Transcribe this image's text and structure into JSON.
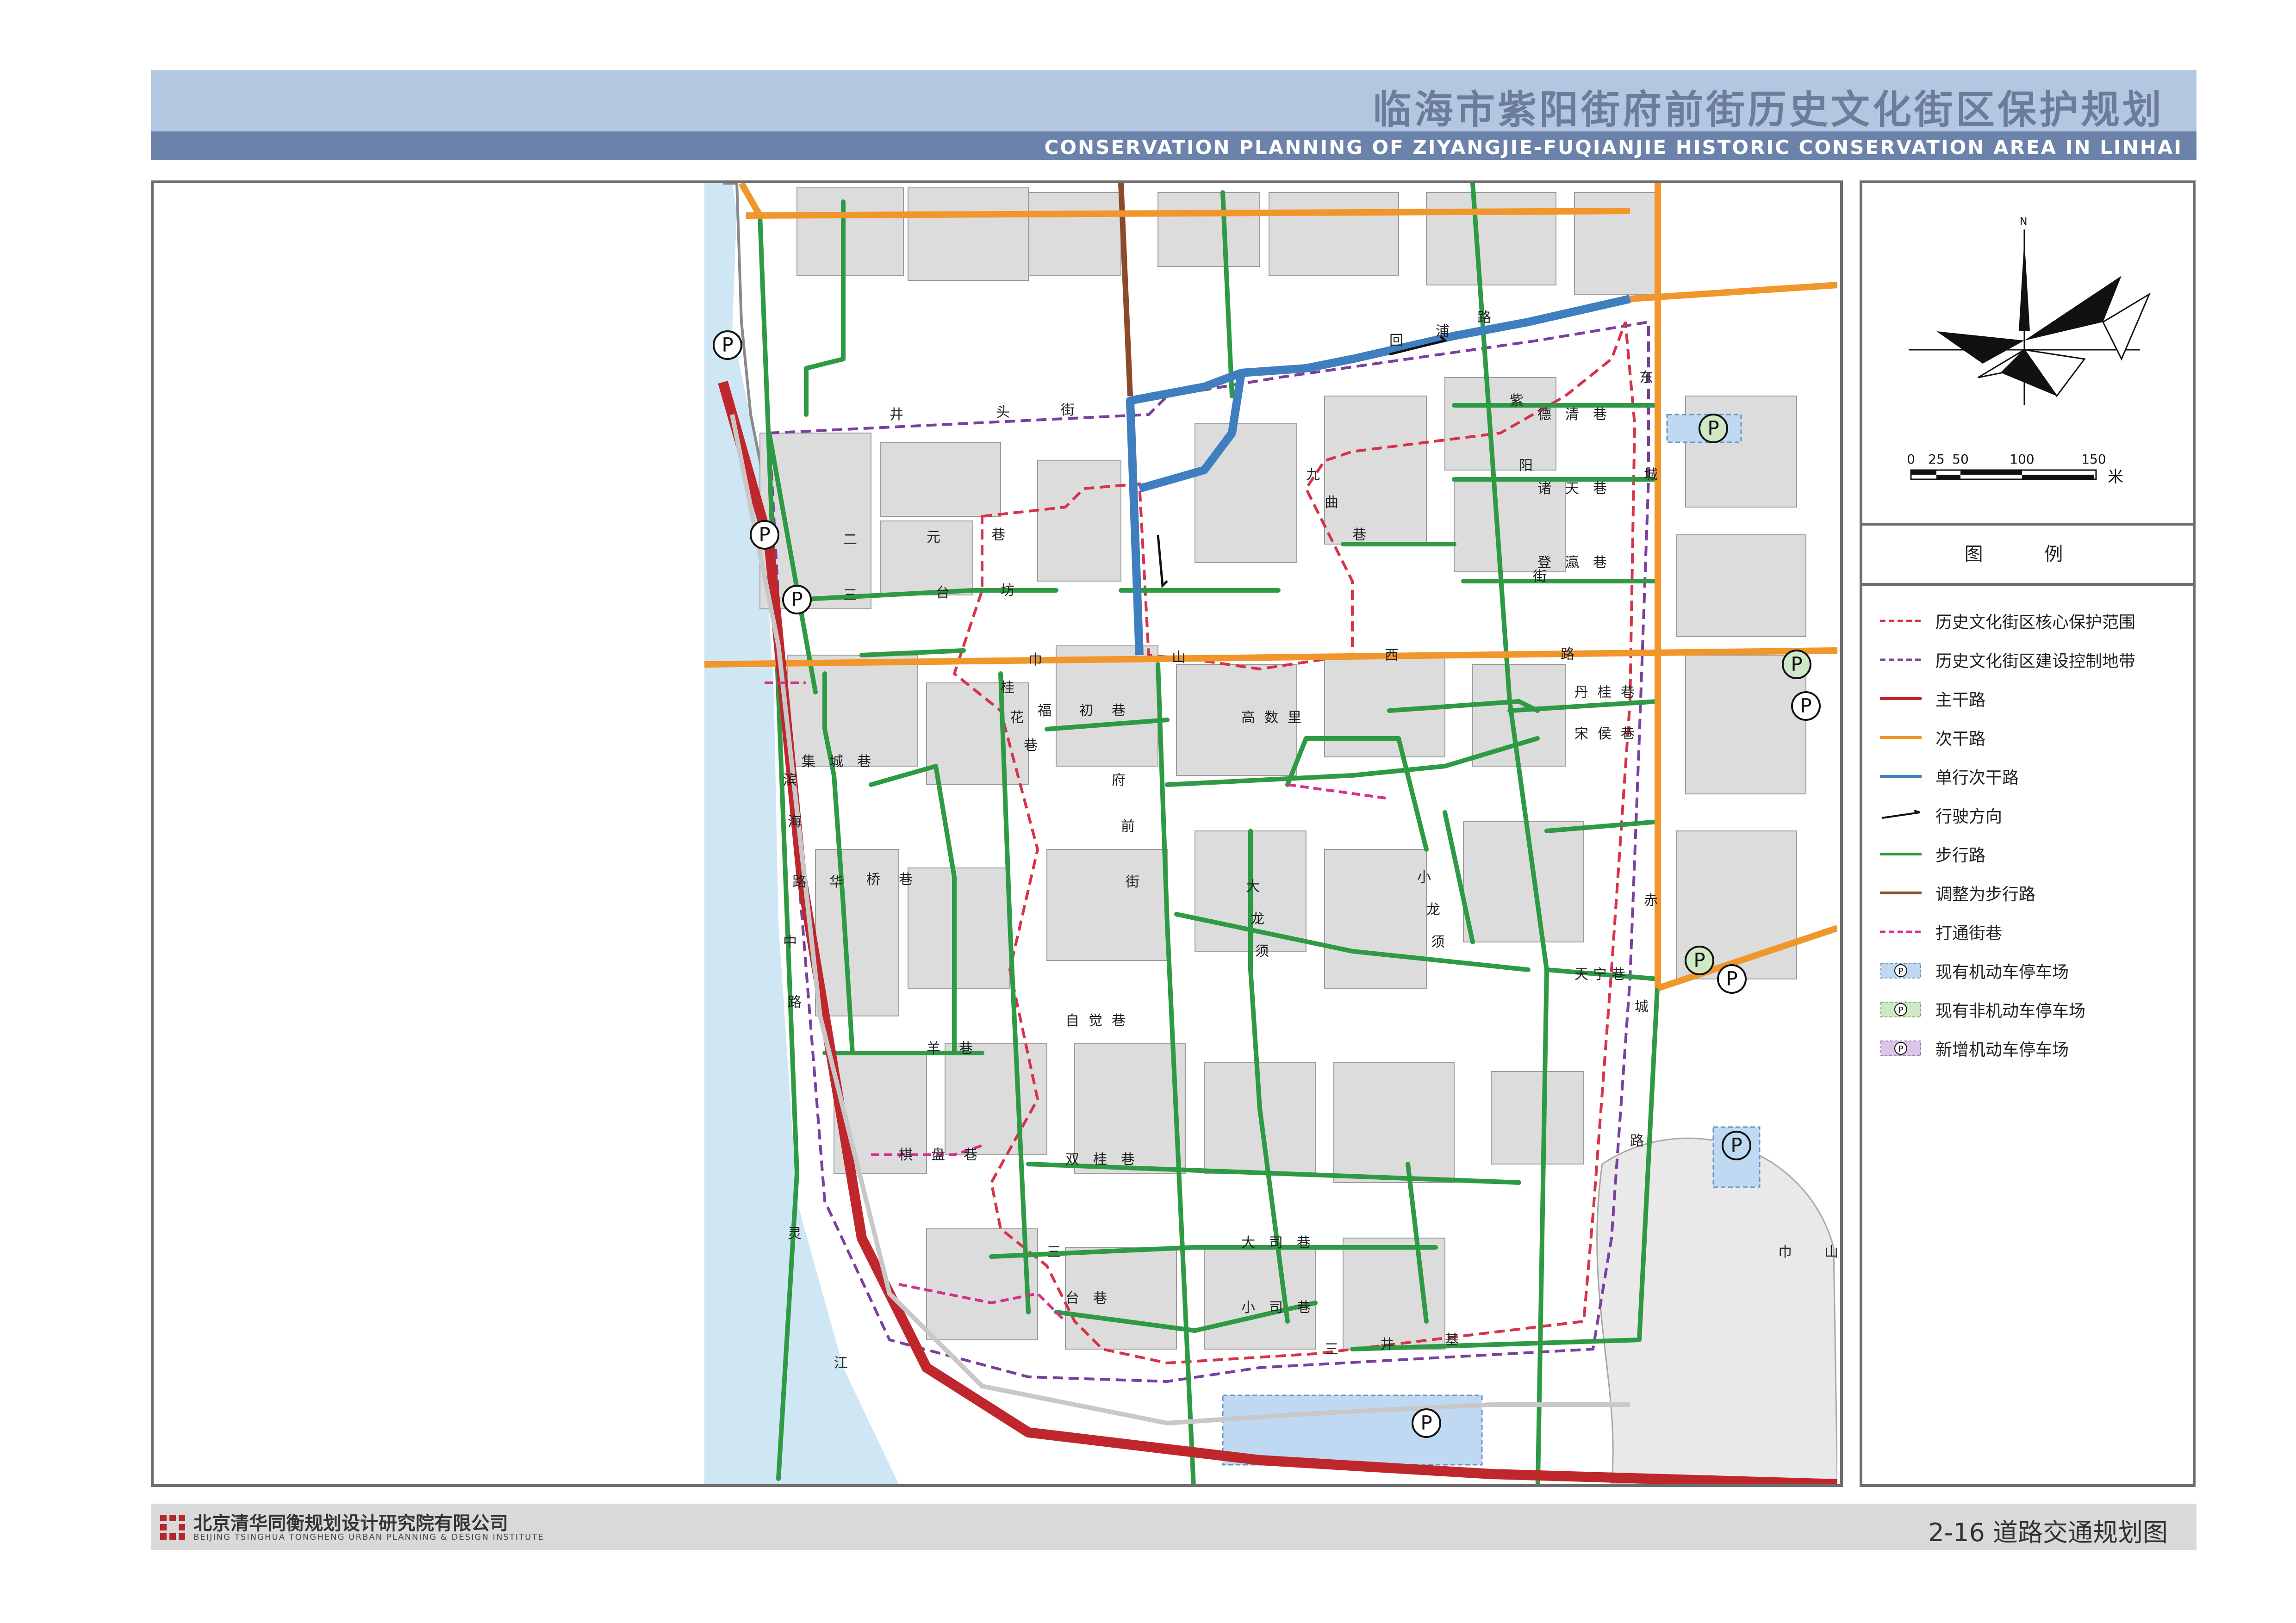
{
  "header": {
    "title": "临海市紫阳街府前街历史文化街区保护规划",
    "subtitle": "CONSERVATION PLANNING OF ZIYANGJIE-FUQIANJIE  HISTORIC CONSERVATION AREA IN LINHAI"
  },
  "compass": {
    "north_label": "N"
  },
  "scale_bar": {
    "ticks": [
      "0",
      "25",
      "50",
      "100",
      "150"
    ],
    "unit": "米"
  },
  "legend": {
    "title": "图    例",
    "items": [
      {
        "label": "历史文化街区核心保护范围",
        "icon": "dashed-red-line",
        "color": "#d6334a"
      },
      {
        "label": "历史文化街区建设控制地带",
        "icon": "dashed-purple-line",
        "color": "#7b3f9e"
      },
      {
        "label": "主干路",
        "icon": "solid-line",
        "color": "#c0272d"
      },
      {
        "label": "次干路",
        "icon": "solid-line",
        "color": "#f0962a"
      },
      {
        "label": "单行次干路",
        "icon": "solid-line",
        "color": "#3f7fc0"
      },
      {
        "label": "行驶方向",
        "icon": "direction-arrow",
        "color": "#222222"
      },
      {
        "label": "步行路",
        "icon": "solid-line",
        "color": "#2f9a44"
      },
      {
        "label": "调整为步行路",
        "icon": "solid-line",
        "color": "#8b4a2b"
      },
      {
        "label": "打通街巷",
        "icon": "dashed-magenta-line",
        "color": "#d4308a"
      },
      {
        "label": "现有机动车停车场",
        "icon": "parking-blue",
        "color": "#bfd9f2"
      },
      {
        "label": "现有非机动车停车场",
        "icon": "parking-green",
        "color": "#cfe8c6"
      },
      {
        "label": "新增机动车停车场",
        "icon": "parking-purple",
        "color": "#dcc6e6"
      }
    ]
  },
  "map": {
    "place_labels": [
      "井",
      "头",
      "街",
      "二",
      "元",
      "巷",
      "三",
      "台",
      "坊",
      "巾",
      "山",
      "西",
      "路",
      "桂",
      "花",
      "巷",
      "福",
      "初",
      "巷",
      "集",
      "城",
      "巷",
      "滨",
      "海",
      "路",
      "华",
      "桥",
      "巷",
      "高",
      "数",
      "里",
      "大",
      "龙",
      "须",
      "小",
      "龙",
      "须",
      "丹",
      "桂",
      "巷",
      "宋",
      "侯",
      "巷",
      "天",
      "宁",
      "巷",
      "自",
      "觉",
      "巷",
      "羊",
      "巷",
      "双",
      "桂",
      "巷",
      "棋",
      "盘",
      "巷",
      "三",
      "台",
      "巷",
      "灵",
      "江",
      "巾",
      "山",
      "大",
      "司",
      "巷",
      "小",
      "司",
      "巷",
      "三",
      "井",
      "基",
      "九",
      "曲",
      "巷",
      "德",
      "清",
      "巷",
      "诸",
      "天",
      "巷",
      "登",
      "瀛",
      "巷",
      "城",
      "东",
      "赤",
      "城",
      "路",
      "紫",
      "阳",
      "街",
      "回",
      "浦",
      "路",
      "中",
      "路",
      "府",
      "前",
      "街"
    ],
    "parking_symbol": "P"
  },
  "footer": {
    "company_cn": "北京清华同衡规划设计研究院有限公司",
    "company_en": "BEIJING TSINGHUA TONGHENG URBAN PLANNING & DESIGN INSTITUTE",
    "sheet": "2-16   道路交通规划图"
  }
}
